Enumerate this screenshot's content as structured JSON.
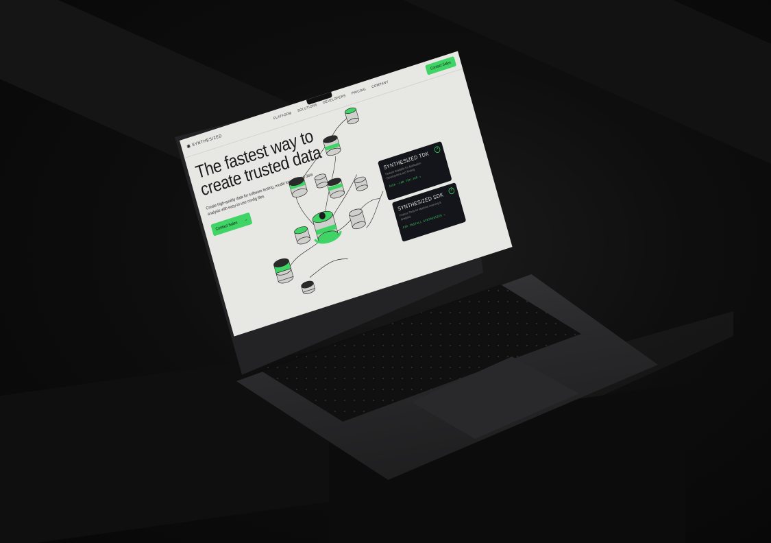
{
  "colors": {
    "accent": "#3fd465",
    "site_background": "#e7e8e4",
    "card_background": "#14151a",
    "scene_background": "#0b0b0b"
  },
  "site": {
    "logo": "SYNTHESIZED",
    "nav": {
      "links": [
        "PLATFORM",
        "SOLUTIONS",
        "DEVELOPERS",
        "PRICING",
        "COMPANY"
      ],
      "cta": "Contact Sales"
    },
    "hero": {
      "title_line1": "The fastest way to",
      "title_line2": "create trusted data",
      "subtitle": "Create high-quality data for software testing, model training, and data analysis with easy-to-use config files.",
      "cta": "Contact Sales",
      "cta_arrow": "→"
    },
    "cards": [
      {
        "title": "SYNTHESIZED TDK",
        "description": "Feature Available for Application Development and Testing",
        "command": "JAVA -JAR TDK.JAR ↘",
        "icon": "arrow-circle-icon"
      },
      {
        "title": "SYNTHESIZED SDK",
        "description": "Feature Tools for Machine Learning & Analytics",
        "command": "PIP INSTALL SYNTHESIZED ↘",
        "icon": "arrow-circle-icon"
      }
    ]
  }
}
